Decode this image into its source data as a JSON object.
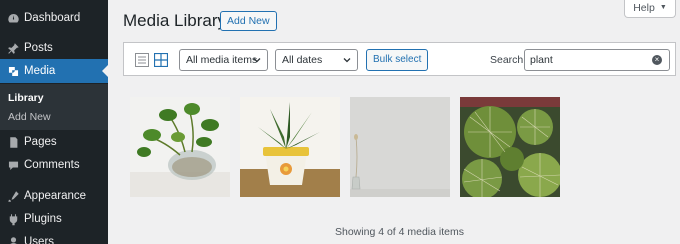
{
  "sidebar": {
    "items": [
      {
        "label": "Dashboard",
        "icon": "dashboard-icon"
      },
      {
        "label": "Posts",
        "icon": "pin-icon"
      },
      {
        "label": "Media",
        "icon": "media-icon",
        "active": true
      },
      {
        "label": "Pages",
        "icon": "pages-icon"
      },
      {
        "label": "Comments",
        "icon": "comments-icon"
      },
      {
        "label": "Appearance",
        "icon": "appearance-icon"
      },
      {
        "label": "Plugins",
        "icon": "plugins-icon"
      },
      {
        "label": "Users",
        "icon": "users-icon"
      }
    ],
    "submenu": [
      {
        "label": "Library",
        "current": true
      },
      {
        "label": "Add New"
      }
    ]
  },
  "header": {
    "title": "Media Library",
    "add_new_label": "Add New",
    "help_label": "Help"
  },
  "toolbar": {
    "type_filter": "All media items",
    "date_filter": "All dates",
    "bulk_label": "Bulk select",
    "search_label": "Search",
    "search_value": "plant"
  },
  "grid": {
    "items": [
      {
        "alt": "pothos plant in glass bowl"
      },
      {
        "alt": "snake plant in yellow pot"
      },
      {
        "alt": "glass bud vase"
      },
      {
        "alt": "cactus close-up"
      }
    ]
  },
  "status": "Showing 4 of 4 media items",
  "colors": {
    "sidebar_bg": "#1d2327",
    "accent": "#2271b1",
    "page_bg": "#f0f0f1"
  }
}
